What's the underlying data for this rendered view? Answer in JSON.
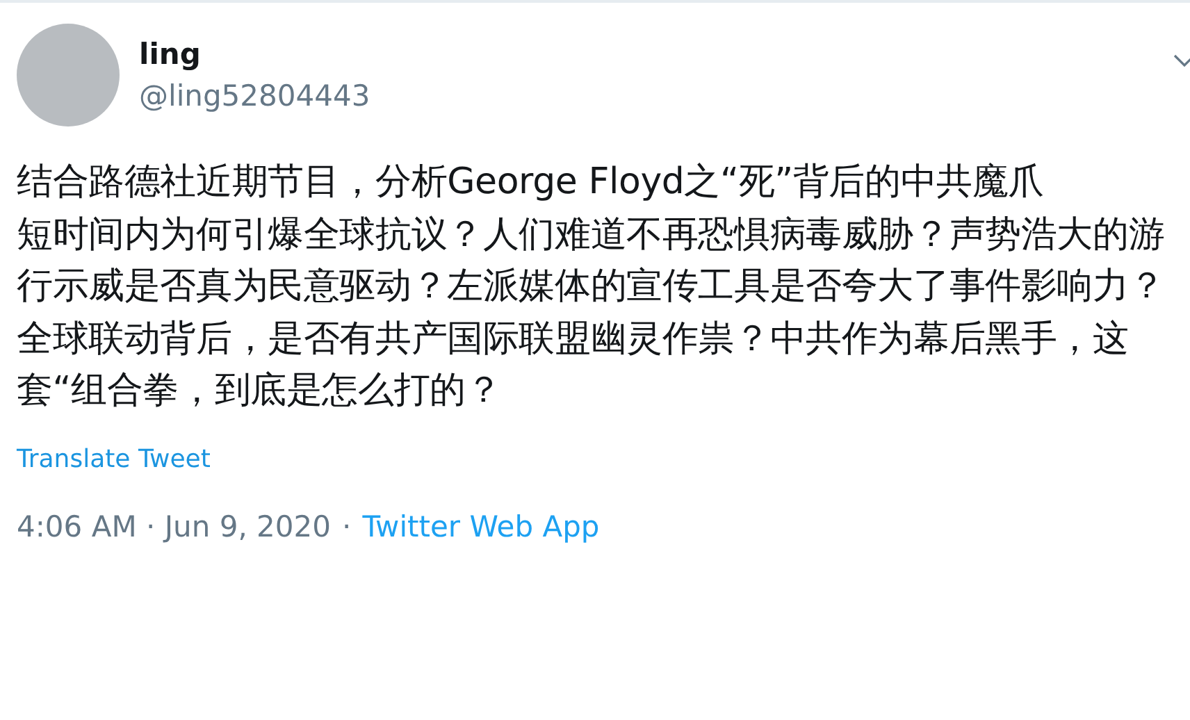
{
  "author": {
    "name": "ling",
    "handle": "@ling52804443"
  },
  "paragraphs": [
    "结合路德社近期节目，分析George Floyd之“死”背后的中共魔爪",
    "短时间内为何引爆全球抗议？人们难道不再恐惧病毒威胁？声势浩大的游行示威是否真为民意驱动？左派媒体的宣传工具是否夸大了事件影响力？全球联动背后，是否有共产国际联盟幽灵作祟？中共作为幕后黑手，这套“组合拳，到底是怎么打的？"
  ],
  "translate_link": "Translate Tweet",
  "meta": {
    "timestamp": "4:06 AM · Jun 9, 2020",
    "separator": "·",
    "source": "Twitter Web App"
  }
}
